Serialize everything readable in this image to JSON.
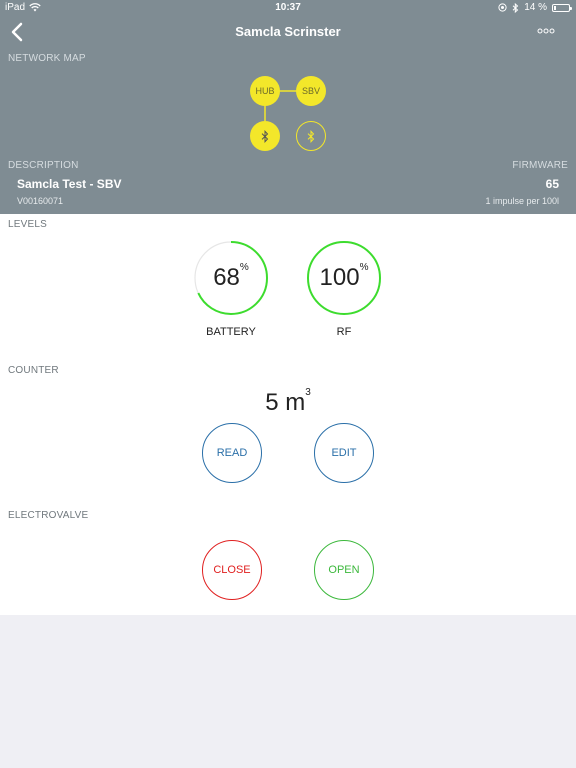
{
  "status_bar": {
    "device": "iPad",
    "time": "10:37",
    "battery_text": "14 %",
    "battery_level": 0.14
  },
  "nav": {
    "title": "Samcla Scrinster",
    "back_icon": "chevron-left-icon",
    "more_icon": "ellipsis-icon"
  },
  "network_map": {
    "label": "NETWORK MAP",
    "nodes": {
      "hub": "HUB",
      "sbv": "SBV"
    },
    "node_color": "#f3e72a"
  },
  "description": {
    "label": "DESCRIPTION",
    "name": "Samcla Test - SBV",
    "serial": "V00160071"
  },
  "firmware": {
    "label": "FIRMWARE",
    "version": "65",
    "impulse": "1 impulse per 100l"
  },
  "levels": {
    "label": "LEVELS",
    "battery": {
      "value": "68",
      "unit": "%",
      "percent": 68,
      "label": "BATTERY"
    },
    "rf": {
      "value": "100",
      "unit": "%",
      "percent": 100,
      "label": "RF"
    },
    "arc_color": "#3ddc2e"
  },
  "counter": {
    "label": "COUNTER",
    "value": "5 m",
    "unit_exp": "3",
    "read_label": "READ",
    "edit_label": "EDIT"
  },
  "electrovalve": {
    "label": "ELECTROVALVE",
    "close_label": "CLOSE",
    "open_label": "OPEN"
  },
  "colors": {
    "header_bg": "#7f8c93",
    "blue": "#2a6fa8",
    "red": "#e02020",
    "green": "#3cb83c"
  }
}
